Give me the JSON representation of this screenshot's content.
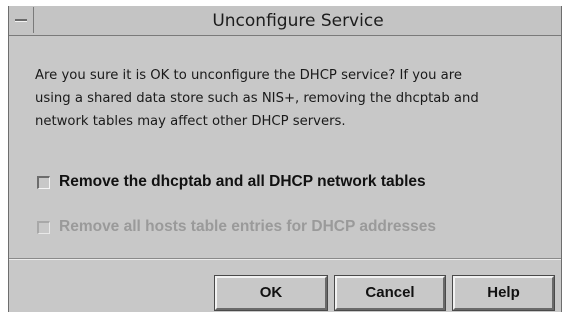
{
  "window": {
    "title": "Unconfigure Service",
    "menu_icon": "window-menu-icon"
  },
  "message": {
    "line1": "Are you sure it is OK to unconfigure the DHCP service?  If you are",
    "line2": "using a shared data store such as NIS+, removing the dhcptab and",
    "line3": "network tables may affect other DHCP servers."
  },
  "options": [
    {
      "label": "Remove the dhcptab and all DHCP network tables",
      "checked": false,
      "enabled": true
    },
    {
      "label": "Remove all hosts table entries for DHCP addresses",
      "checked": false,
      "enabled": false
    }
  ],
  "buttons": {
    "ok": "OK",
    "cancel": "Cancel",
    "help": "Help"
  },
  "colors": {
    "background": "#c8c8c8",
    "disabled_text": "#9a9a9a"
  }
}
